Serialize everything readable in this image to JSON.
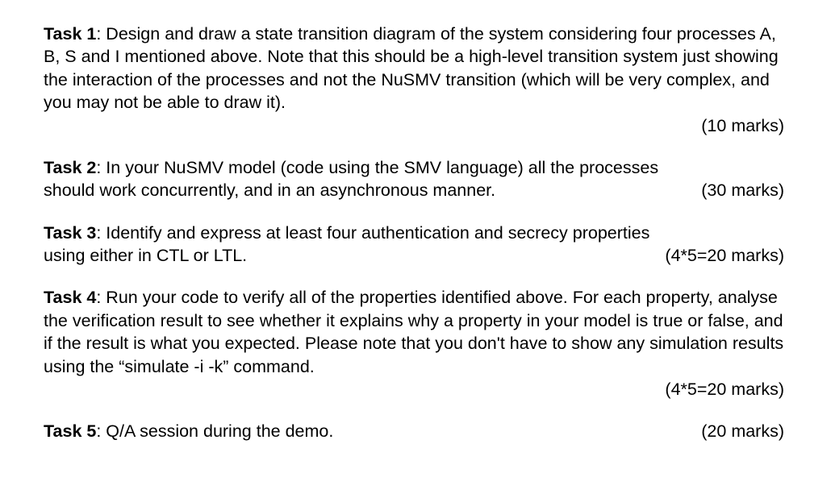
{
  "tasks": [
    {
      "label": "Task 1",
      "text_line1": ": Design and draw a state transition diagram of the system considering four processes A, B, S and I mentioned above. Note that this should be a high-level transition system just showing the interaction of the processes and not the NuSMV transition (which will be very complex, and you may not be able to draw it).",
      "marks": "(10 marks)",
      "layout": "marks_below"
    },
    {
      "label": "Task 2",
      "text_before": ": In your NuSMV model (code using the SMV language) all the processes",
      "text_inline_left": "should work concurrently, and in an asynchronous manner.",
      "marks": "(30 marks)",
      "layout": "marks_inline_last"
    },
    {
      "label": "Task 3",
      "text_before": ": Identify and express at least four authentication and secrecy properties",
      "text_inline_left": "using either in CTL or LTL.",
      "marks": "(4*5=20 marks)",
      "layout": "marks_inline_last"
    },
    {
      "label": "Task 4",
      "text_line1": ": Run your code to verify all of the properties identified above. For each property, analyse the verification result to see whether it explains why a property in your model is true or false, and if the result is what you expected. Please note that you don't have to show any simulation results using the “simulate -i -k” command.",
      "marks": "(4*5=20 marks)",
      "layout": "marks_below"
    },
    {
      "label": "Task 5",
      "text_inline_left": ": Q/A session during the demo.",
      "marks": "(20 marks)",
      "layout": "marks_inline_only"
    }
  ]
}
